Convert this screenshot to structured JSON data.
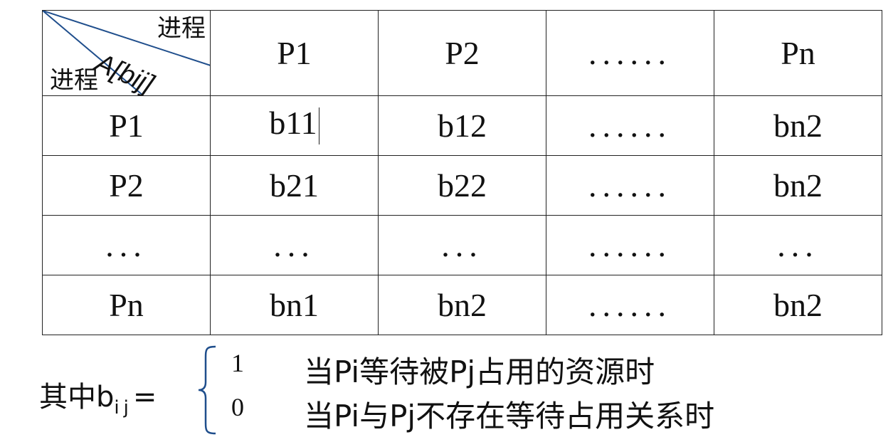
{
  "matrix": {
    "corner": {
      "col_header": "进程",
      "matrix_label": "A[bij]",
      "row_header": "进程"
    },
    "columns": [
      "P1",
      "P2",
      "......",
      "Pn"
    ],
    "rows": [
      {
        "label": "P1",
        "cells": [
          "b11",
          "b12",
          "......",
          "bn2"
        ]
      },
      {
        "label": "P2",
        "cells": [
          "b21",
          "b22",
          "......",
          "bn2"
        ]
      },
      {
        "label": "...",
        "cells": [
          "...",
          "...",
          "......",
          "..."
        ]
      },
      {
        "label": "Pn",
        "cells": [
          "bn1",
          "bn2",
          "......",
          "bn2"
        ]
      }
    ]
  },
  "definition": {
    "prefix": "其中b",
    "subscript": "ij",
    "equals": "=",
    "cases": [
      {
        "value": "1",
        "condition": "当Pi等待被Pj占用的资源时"
      },
      {
        "value": "0",
        "condition": "当Pi与Pj不存在等待占用关系时"
      }
    ]
  },
  "colors": {
    "text": "#111111",
    "grid": "#222222",
    "diagonal": "#1f4e8c",
    "brace": "#1f4e8c"
  }
}
